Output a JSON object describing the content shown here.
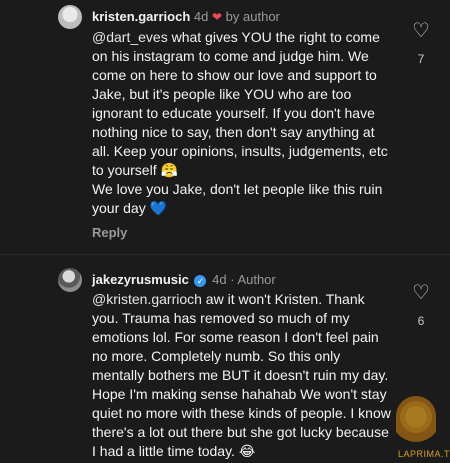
{
  "comment1": {
    "username": "kristen.garrioch",
    "time": "4d",
    "by_author": "by author",
    "mention": "@dart_eves",
    "body": " what gives YOU the right to come on his instagram to come and judge him. We come on here to show our love and support to Jake, but it's people like YOU who are too ignorant to educate yourself. If you don't have nothing nice to say, then don't say anything at all. Keep your opinions, insults, judgements, etc to yourself 😤",
    "body2": "We love you Jake, don't let people like this ruin your day 💙",
    "reply": "Reply",
    "likes": "7",
    "icons": {
      "author_like": "heart-icon",
      "like": "heart-outline-icon",
      "avatar": "avatar"
    }
  },
  "comment2": {
    "username": "jakezyrusmusic",
    "time": "4d",
    "separator": "·",
    "author_label": "Author",
    "mention": "@kristen.garrioch",
    "body": " aw it won't Kristen. Thank you. Trauma has removed so much of my emotions lol. For some reason I don't feel pain no more. Completely numb. So this only mentally bothers me BUT it doesn't ruin my day. Hope I'm making sense hahahab We won't stay quiet no more with these kinds of people. I know there's a lot out there but she got lucky because I had a little time today. 😂",
    "likes": "6",
    "icons": {
      "verified": "verified-badge-icon",
      "like": "heart-outline-icon"
    }
  },
  "watermark": {
    "text": "LAPRIMA.TV"
  },
  "colors": {
    "background": "#1b1b1b",
    "heart": "#ed4956",
    "verified": "#3897f0"
  }
}
